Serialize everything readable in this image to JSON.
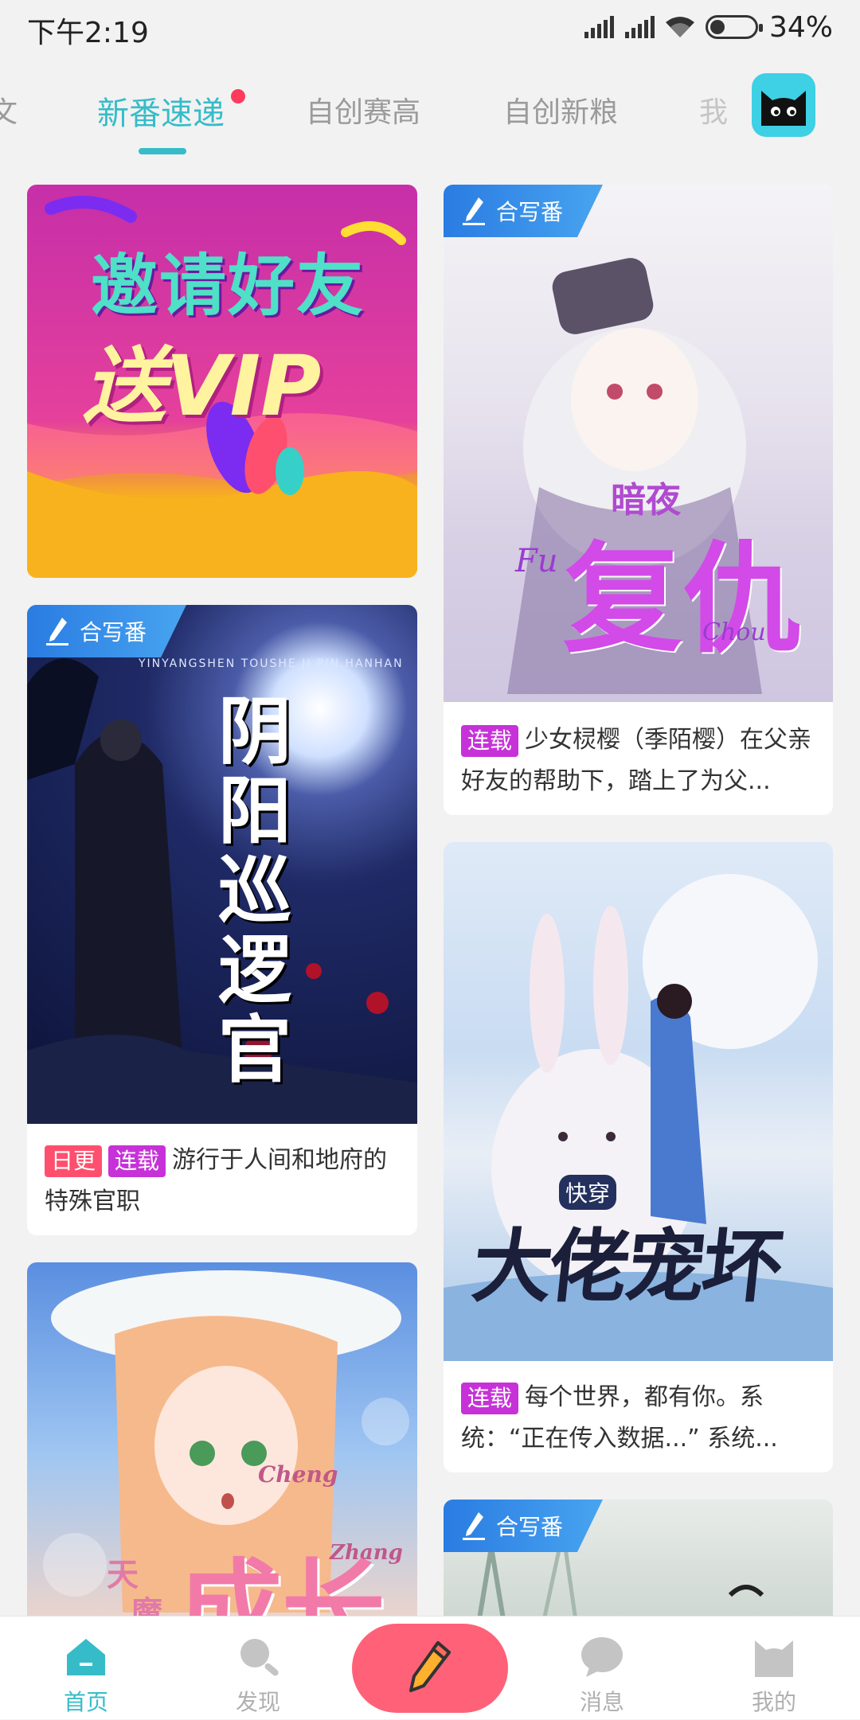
{
  "status": {
    "time": "下午2:19",
    "battery": "34%",
    "battery_level": 0.34
  },
  "tabs": [
    {
      "label": "文"
    },
    {
      "label": "新番速递",
      "active": true
    },
    {
      "label": "自创赛高"
    },
    {
      "label": "自创新粮"
    },
    {
      "label": "我"
    }
  ],
  "colors": {
    "accent": "#36bcc8",
    "serial_tag": "#c632d8",
    "daily_tag": "#ff4f6e",
    "fab": "#ff6178",
    "badge": "#2a7ce2"
  },
  "banner": {
    "line1": "邀请好友",
    "line2": "送VIP"
  },
  "cards": {
    "fuchou": {
      "badge": "合写番",
      "cover_title": "暗夜",
      "cover_big": "复仇",
      "cover_fu": "Fu",
      "cover_chou": "Chou",
      "tag": "连载",
      "text": "少女棂樱（季陌樱）在父亲好友的帮助下，踏上了为父..."
    },
    "yinyang": {
      "badge": "合写番",
      "cover_small": "YINYANGSHEN TOUSHE JI PIN HANHAN",
      "cover_title": "阴阳巡逻官",
      "tag_daily": "日更",
      "tag": "连载",
      "text": "游行于人间和地府的特殊官职"
    },
    "kuaichuan": {
      "cover_small": "快穿",
      "cover_title": "大佬宠坏",
      "tag": "连载",
      "text": "每个世界，都有你。系统：“正在传入数据...” 系统..."
    },
    "chengzhang": {
      "cover_cheng": "Cheng",
      "cover_zhang": "Zhang",
      "cover_tian": "天",
      "cover_mo": "魔",
      "cover_big": "成长"
    },
    "fifth": {
      "badge": "合写番"
    }
  },
  "nav": [
    {
      "label": "首页",
      "icon": "home-icon",
      "active": true
    },
    {
      "label": "发现",
      "icon": "search-icon"
    },
    {
      "label": "",
      "icon": "pencil-icon"
    },
    {
      "label": "消息",
      "icon": "chat-icon"
    },
    {
      "label": "我的",
      "icon": "cat-profile-icon"
    }
  ]
}
